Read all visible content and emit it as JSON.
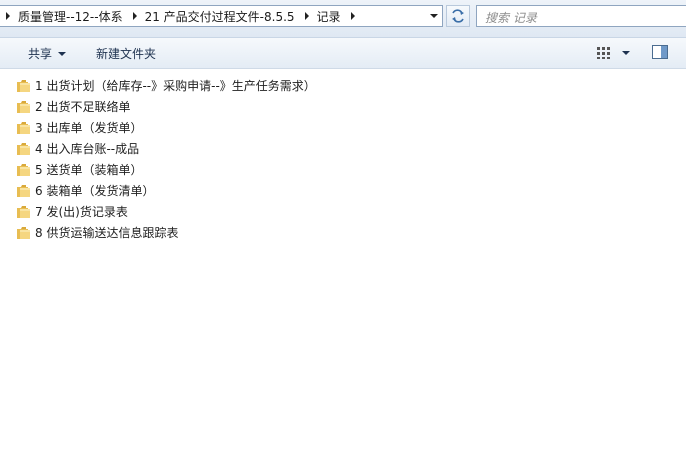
{
  "address": {
    "crumbs": [
      "质量管理--12--体系",
      "21 产品交付过程文件-8.5.5",
      "记录"
    ]
  },
  "search": {
    "placeholder": "搜索 记录"
  },
  "toolbar": {
    "share_label": "共享",
    "new_folder_label": "新建文件夹"
  },
  "files": [
    "1 出货计划（给库存--》采购申请--》生产任务需求）",
    "2 出货不足联络单",
    "3 出库单（发货单）",
    "4 出入库台账--成品",
    "5 送货单（装箱单）",
    "6 装箱单（发货清单）",
    "7 发(出)货记录表",
    "8 供货运输送达信息跟踪表"
  ]
}
